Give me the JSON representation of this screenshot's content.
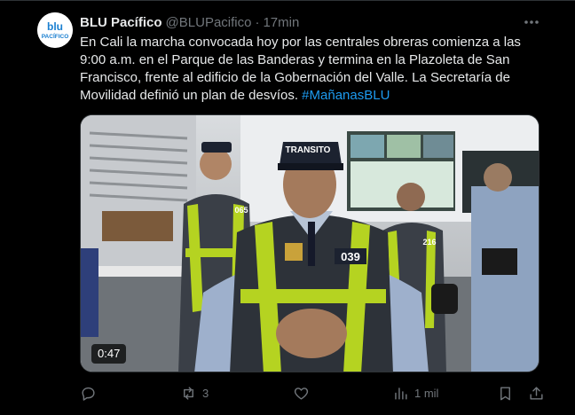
{
  "tweet": {
    "avatar_text": "blu PACÍFICO",
    "display_name": "BLU Pacífico",
    "handle": "@BLUPacifico",
    "separator": "·",
    "time": "17min",
    "text_before_hashtag": "En Cali la marcha convocada hoy por las centrales obreras comienza a las 9:00 a.m. en el Parque de las Banderas y termina en la Plazoleta de San Francisco, frente al edificio de la Gobernación del Valle. La Secretaría de Movilidad definió un plan de desvíos. ",
    "hashtag": "#MañanasBLU"
  },
  "media": {
    "duration": "0:47",
    "cap_text": "TRANSITO",
    "badge_center": "039",
    "badge_left": "065",
    "badge_right": "216"
  },
  "actions": {
    "reply": {
      "icon": "reply-icon",
      "count": ""
    },
    "repost": {
      "icon": "repost-icon",
      "count": "3"
    },
    "like": {
      "icon": "like-icon",
      "count": ""
    },
    "views": {
      "icon": "views-icon",
      "count": "1 mil"
    },
    "bookmark": {
      "icon": "bookmark-icon",
      "count": ""
    },
    "share": {
      "icon": "share-icon",
      "count": ""
    }
  },
  "colors": {
    "background": "#000000",
    "text": "#e7e9ea",
    "muted": "#71767b",
    "link": "#1d9bf0",
    "vest": "#b5d321"
  }
}
